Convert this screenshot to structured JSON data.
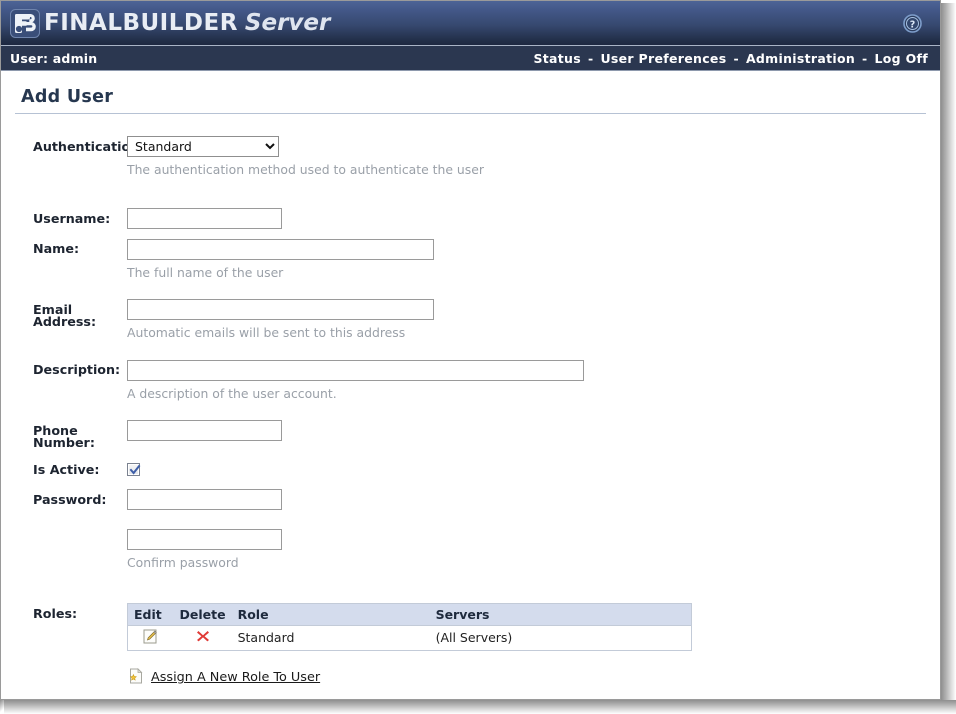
{
  "header": {
    "brand_primary": "FINALBUILDER",
    "brand_secondary": "Server",
    "logo_icon": "fb-logo-icon",
    "help_icon": "help-circle-icon",
    "gradient_top": "#4d6496",
    "gradient_bottom": "#1e2840"
  },
  "subbar": {
    "user_label": "User: admin",
    "separator": "-",
    "links": [
      {
        "label": "Status"
      },
      {
        "label": "User Preferences"
      },
      {
        "label": "Administration"
      },
      {
        "label": "Log Off"
      }
    ],
    "background": "#2b3750"
  },
  "page": {
    "title": "Add User"
  },
  "form": {
    "authentication": {
      "label": "Authentication:",
      "value": "Standard",
      "options": [
        "Standard"
      ],
      "hint": "The authentication method used to authenticate the user"
    },
    "username": {
      "label": "Username:",
      "value": "",
      "placeholder": ""
    },
    "name": {
      "label": "Name:",
      "value": "",
      "placeholder": "",
      "hint": "The full name of the user"
    },
    "email": {
      "label": "Email Address:",
      "value": "",
      "placeholder": "",
      "hint": "Automatic emails will be sent to this address"
    },
    "description": {
      "label": "Description:",
      "value": "",
      "placeholder": "",
      "hint": "A description of the user account."
    },
    "phone": {
      "label": "Phone Number:",
      "value": "",
      "placeholder": ""
    },
    "is_active": {
      "label": "Is Active:",
      "checked": true
    },
    "password": {
      "label": "Password:",
      "value": "",
      "placeholder": ""
    },
    "confirm_password": {
      "value": "",
      "placeholder": "",
      "hint": "Confirm password"
    }
  },
  "roles": {
    "label": "Roles:",
    "columns": [
      "Edit",
      "Delete",
      "Role",
      "Servers"
    ],
    "rows": [
      {
        "edit_icon": "pencil-edit-icon",
        "delete_icon": "red-x-delete-icon",
        "role": "Standard",
        "servers": "(All Servers)"
      }
    ],
    "assign_link": {
      "icon": "new-page-star-icon",
      "label": "Assign A New Role To User"
    },
    "header_background": "#d4dced"
  }
}
